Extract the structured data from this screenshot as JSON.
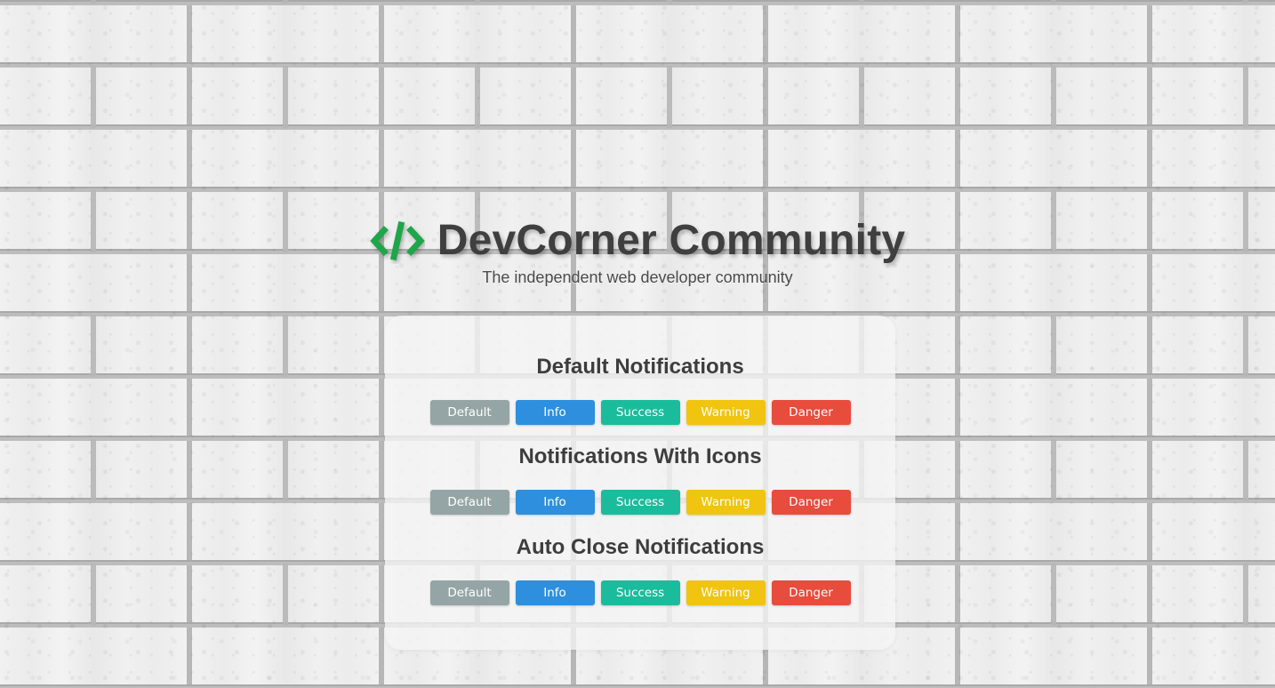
{
  "header": {
    "title": "DevCorner Community",
    "tagline": "The independent web developer community",
    "logo_icon": "code-brackets-icon",
    "logo_color": "#1fa64a"
  },
  "sections": [
    {
      "title": "Default Notifications",
      "buttons": [
        "Default",
        "Info",
        "Success",
        "Warning",
        "Danger"
      ]
    },
    {
      "title": "Notifications With Icons",
      "buttons": [
        "Default",
        "Info",
        "Success",
        "Warning",
        "Danger"
      ]
    },
    {
      "title": "Auto Close Notifications",
      "buttons": [
        "Default",
        "Info",
        "Success",
        "Warning",
        "Danger"
      ]
    }
  ],
  "colors": {
    "default": "#95a5a6",
    "info": "#2d8fde",
    "success": "#1abc9c",
    "warning": "#f1c40f",
    "danger": "#e74c3c"
  }
}
